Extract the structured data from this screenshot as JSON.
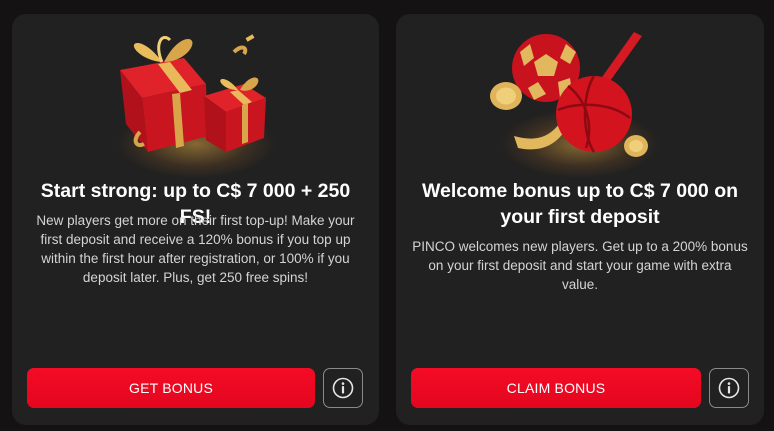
{
  "cards": [
    {
      "title": "Start strong: up to C$ 7 000 + 250 FS!",
      "description": "New players get more on their first top-up! Make your first deposit and receive a 120% bonus if you top up within the first hour after registration, or 100% if you deposit later. Plus, get 250 free spins!",
      "button_label": "GET BONUS",
      "image_icon": "gift-boxes-icon",
      "info_icon": "info-icon"
    },
    {
      "title": "Welcome bonus up to C$ 7 000 on your first deposit",
      "description": "PINCO welcomes new players. Get up to a 200% bonus on your first deposit and start your game with extra value.",
      "button_label": "CLAIM BONUS",
      "image_icon": "sports-balls-icon",
      "info_icon": "info-icon"
    }
  ],
  "colors": {
    "background": "#151213",
    "card": "#212121",
    "accent": "#f50b26",
    "gold": "#d9a54a"
  }
}
